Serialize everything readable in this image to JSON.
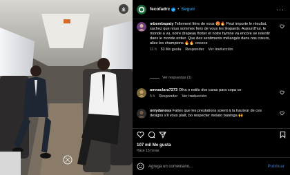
{
  "header": {
    "username": "fecofadrc",
    "separator": "•",
    "follow_label": "Seguir",
    "more_label": "···"
  },
  "comments": [
    {
      "username": "mbembapaty",
      "text": "Tellement fière de vous 😍🔥 Peut importe le résultat, sachez que nous sommes fiers de vous les léopards. Aujourd'hui, le monde a vu, notre drapeau flotter et notre hymne va encore se retentir dans le monde entier. Que des sentiments mélangés dans nos cœurs, allez les champions 🔥🔥 cocece",
      "time": "11 h",
      "likes": "53 Me gusta",
      "reply": "Responder",
      "translate": "Ver traducción"
    },
    {
      "username": "amnaclara7273",
      "text": "Olha o estilo dos caras para copa ce",
      "time": "5 h",
      "likes": "",
      "reply": "Responder",
      "translate": "Ver traducción"
    },
    {
      "username": "onlydanoss",
      "text": "Faites que les prestations soient à la hauteur de ces designs s'il vous plaît, bo respecter molato baninga 🙌",
      "time": "",
      "likes": "",
      "reply": "",
      "translate": ""
    }
  ],
  "view_replies": "Ver respuestas (1)",
  "likes_total": "107 mil Me gusta",
  "posted_ago": "Hace 15 horas",
  "comment_box": {
    "placeholder": "Agrega un comentario...",
    "publish_label": "Publicar"
  },
  "colors": {
    "accent": "#0095f6",
    "background": "#000000",
    "muted": "#a8a8a8",
    "publish_disabled": "#385b84"
  },
  "icons": [
    "download-icon",
    "verified-icon",
    "heart-icon",
    "comment-icon",
    "share-icon",
    "bookmark-icon",
    "emoji-icon"
  ]
}
